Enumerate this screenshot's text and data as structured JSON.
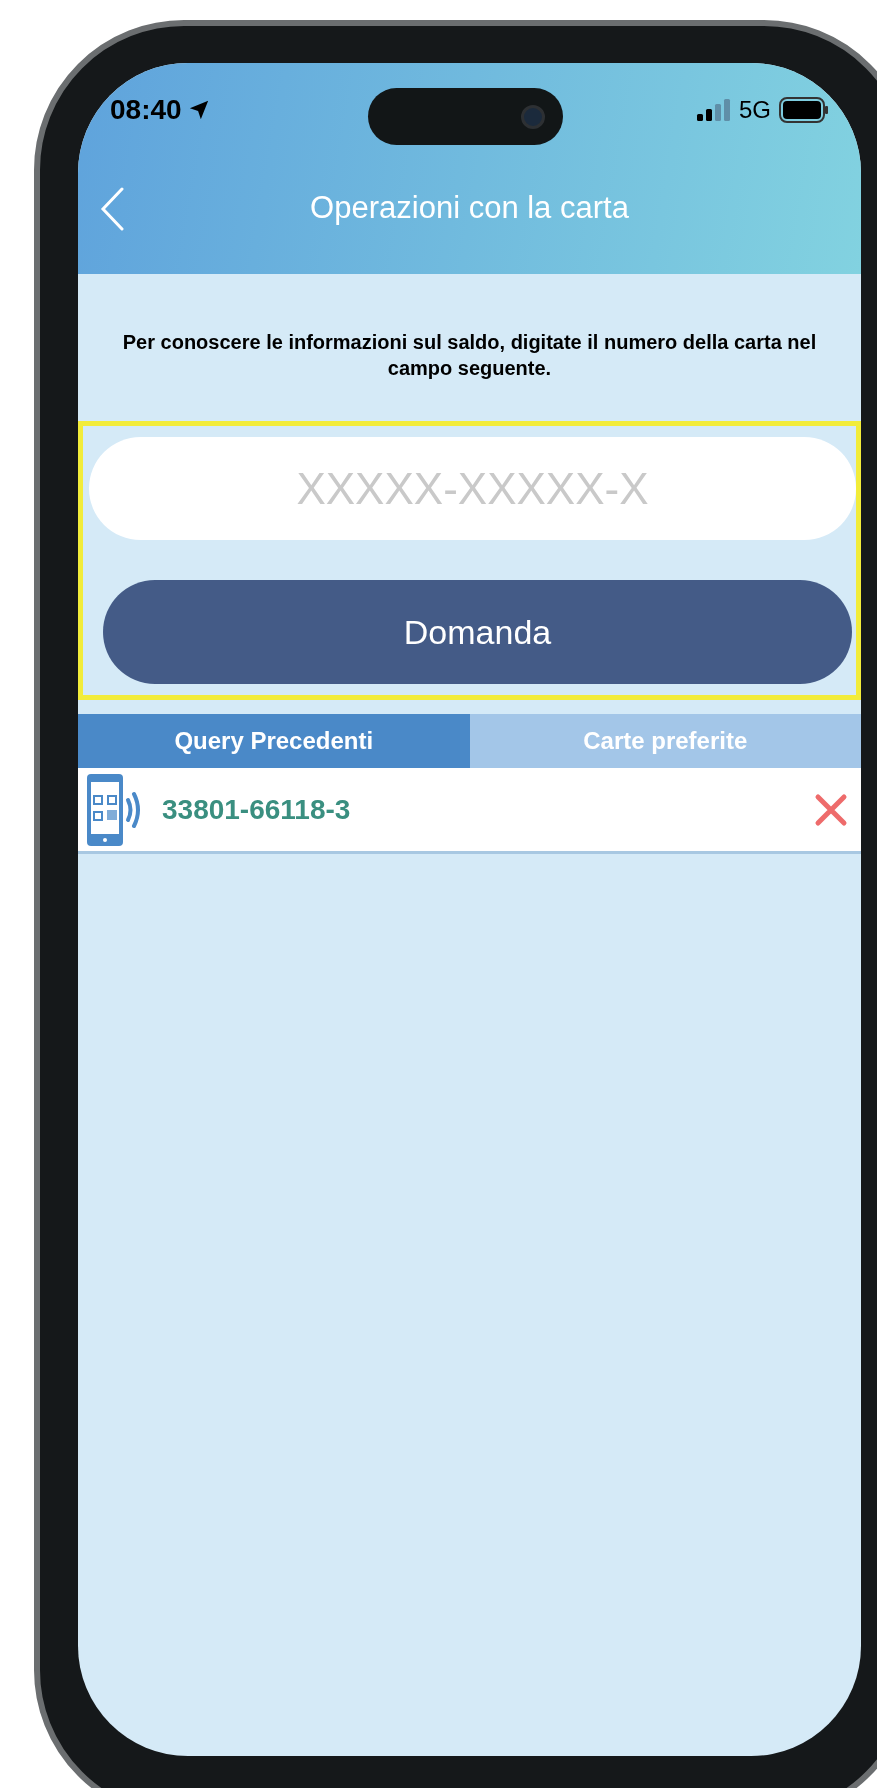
{
  "status_bar": {
    "time": "08:40",
    "network": "5G"
  },
  "nav": {
    "title": "Operazioni con la carta"
  },
  "instruction": "Per conoscere le informazioni sul saldo, digitate il numero della carta nel campo seguente.",
  "card_field": {
    "placeholder": "XXXXX-XXXXX-X"
  },
  "submit_button": "Domanda",
  "tabs": [
    {
      "label": "Query Precedenti",
      "selected": true
    },
    {
      "label": "Carte preferite",
      "selected": false
    }
  ],
  "history": [
    {
      "card_number": "33801-66118-3"
    }
  ]
}
